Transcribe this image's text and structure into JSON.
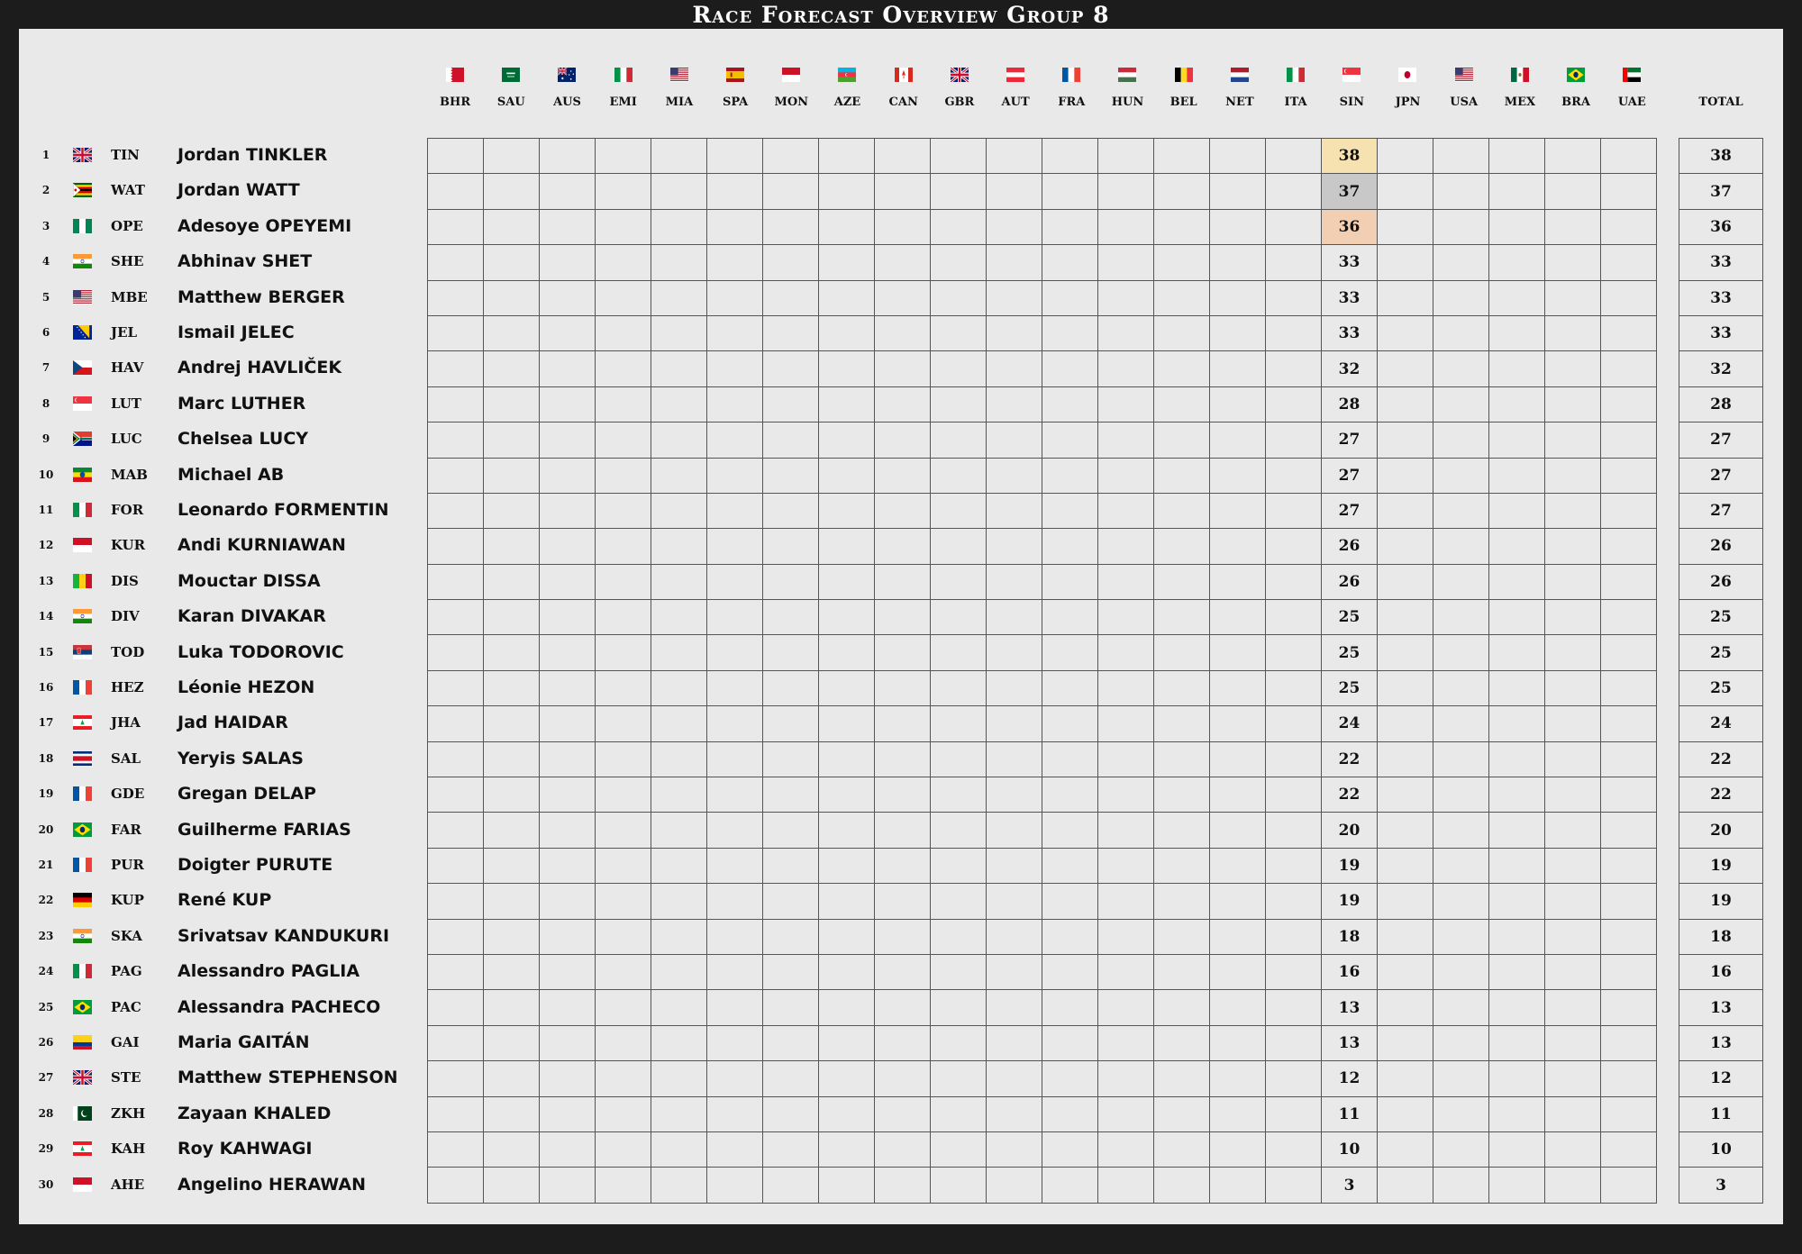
{
  "title": "Race Forecast Overview Group 8",
  "total_label": "TOTAL",
  "highlight_colors": {
    "first": "#f6e2b0",
    "second": "#c8c8c8",
    "third": "#f2cfb2"
  },
  "races": [
    {
      "code": "BHR",
      "flag": "bahrain-flag"
    },
    {
      "code": "SAU",
      "flag": "saudi-arabia-flag"
    },
    {
      "code": "AUS",
      "flag": "australia-flag"
    },
    {
      "code": "EMI",
      "flag": "italy-flag"
    },
    {
      "code": "MIA",
      "flag": "usa-flag"
    },
    {
      "code": "SPA",
      "flag": "spain-flag"
    },
    {
      "code": "MON",
      "flag": "monaco-flag"
    },
    {
      "code": "AZE",
      "flag": "azerbaijan-flag"
    },
    {
      "code": "CAN",
      "flag": "canada-flag"
    },
    {
      "code": "GBR",
      "flag": "uk-flag"
    },
    {
      "code": "AUT",
      "flag": "austria-flag"
    },
    {
      "code": "FRA",
      "flag": "france-flag"
    },
    {
      "code": "HUN",
      "flag": "hungary-flag"
    },
    {
      "code": "BEL",
      "flag": "belgium-flag"
    },
    {
      "code": "NET",
      "flag": "netherlands-flag"
    },
    {
      "code": "ITA",
      "flag": "italy-flag"
    },
    {
      "code": "SIN",
      "flag": "singapore-flag"
    },
    {
      "code": "JPN",
      "flag": "japan-flag"
    },
    {
      "code": "USA",
      "flag": "usa-flag"
    },
    {
      "code": "MEX",
      "flag": "mexico-flag"
    },
    {
      "code": "BRA",
      "flag": "brazil-flag"
    },
    {
      "code": "UAE",
      "flag": "uae-flag"
    }
  ],
  "score_column": "SIN",
  "players": [
    {
      "rank": "1",
      "flag": "uk-flag",
      "abbr": "TIN",
      "name": "Jordan TINKLER",
      "score": "38",
      "total": "38"
    },
    {
      "rank": "2",
      "flag": "zimbabwe-flag",
      "abbr": "WAT",
      "name": "Jordan WATT",
      "score": "37",
      "total": "37"
    },
    {
      "rank": "3",
      "flag": "nigeria-flag",
      "abbr": "OPE",
      "name": "Adesoye OPEYEMI",
      "score": "36",
      "total": "36"
    },
    {
      "rank": "4",
      "flag": "india-flag",
      "abbr": "SHE",
      "name": "Abhinav SHET",
      "score": "33",
      "total": "33"
    },
    {
      "rank": "5",
      "flag": "usa-flag",
      "abbr": "MBE",
      "name": "Matthew BERGER",
      "score": "33",
      "total": "33"
    },
    {
      "rank": "6",
      "flag": "bosnia-flag",
      "abbr": "JEL",
      "name": "Ismail JELEC",
      "score": "33",
      "total": "33"
    },
    {
      "rank": "7",
      "flag": "czech-flag",
      "abbr": "HAV",
      "name": "Andrej HAVLIČEK",
      "score": "32",
      "total": "32"
    },
    {
      "rank": "8",
      "flag": "singapore-flag",
      "abbr": "LUT",
      "name": "Marc LUTHER",
      "score": "28",
      "total": "28"
    },
    {
      "rank": "9",
      "flag": "south-africa-flag",
      "abbr": "LUC",
      "name": "Chelsea LUCY",
      "score": "27",
      "total": "27"
    },
    {
      "rank": "10",
      "flag": "ethiopia-flag",
      "abbr": "MAB",
      "name": "Michael AB",
      "score": "27",
      "total": "27"
    },
    {
      "rank": "11",
      "flag": "italy-flag",
      "abbr": "FOR",
      "name": "Leonardo FORMENTIN",
      "score": "27",
      "total": "27"
    },
    {
      "rank": "12",
      "flag": "indonesia-flag",
      "abbr": "KUR",
      "name": "Andi KURNIAWAN",
      "score": "26",
      "total": "26"
    },
    {
      "rank": "13",
      "flag": "mali-flag",
      "abbr": "DIS",
      "name": "Mouctar DISSA",
      "score": "26",
      "total": "26"
    },
    {
      "rank": "14",
      "flag": "india-flag",
      "abbr": "DIV",
      "name": "Karan DIVAKAR",
      "score": "25",
      "total": "25"
    },
    {
      "rank": "15",
      "flag": "serbia-flag",
      "abbr": "TOD",
      "name": "Luka TODOROVIC",
      "score": "25",
      "total": "25"
    },
    {
      "rank": "16",
      "flag": "france-flag",
      "abbr": "HEZ",
      "name": "Léonie HEZON",
      "score": "25",
      "total": "25"
    },
    {
      "rank": "17",
      "flag": "lebanon-flag",
      "abbr": "JHA",
      "name": "Jad HAIDAR",
      "score": "24",
      "total": "24"
    },
    {
      "rank": "18",
      "flag": "costa-rica-flag",
      "abbr": "SAL",
      "name": "Yeryis SALAS",
      "score": "22",
      "total": "22"
    },
    {
      "rank": "19",
      "flag": "france-flag",
      "abbr": "GDE",
      "name": "Gregan DELAP",
      "score": "22",
      "total": "22"
    },
    {
      "rank": "20",
      "flag": "brazil-flag",
      "abbr": "FAR",
      "name": "Guilherme FARIAS",
      "score": "20",
      "total": "20"
    },
    {
      "rank": "21",
      "flag": "france-flag",
      "abbr": "PUR",
      "name": "Doigter PURUTE",
      "score": "19",
      "total": "19"
    },
    {
      "rank": "22",
      "flag": "germany-flag",
      "abbr": "KUP",
      "name": "René KUP",
      "score": "19",
      "total": "19"
    },
    {
      "rank": "23",
      "flag": "india-flag",
      "abbr": "SKA",
      "name": "Srivatsav KANDUKURI",
      "score": "18",
      "total": "18"
    },
    {
      "rank": "24",
      "flag": "italy-flag",
      "abbr": "PAG",
      "name": "Alessandro PAGLIA",
      "score": "16",
      "total": "16"
    },
    {
      "rank": "25",
      "flag": "brazil-flag",
      "abbr": "PAC",
      "name": "Alessandra PACHECO",
      "score": "13",
      "total": "13"
    },
    {
      "rank": "26",
      "flag": "colombia-flag",
      "abbr": "GAI",
      "name": "Maria GAITÁN",
      "score": "13",
      "total": "13"
    },
    {
      "rank": "27",
      "flag": "uk-flag",
      "abbr": "STE",
      "name": "Matthew STEPHENSON",
      "score": "12",
      "total": "12"
    },
    {
      "rank": "28",
      "flag": "pakistan-flag",
      "abbr": "ZKH",
      "name": "Zayaan KHALED",
      "score": "11",
      "total": "11"
    },
    {
      "rank": "29",
      "flag": "lebanon-flag",
      "abbr": "KAH",
      "name": "Roy KAHWAGI",
      "score": "10",
      "total": "10"
    },
    {
      "rank": "30",
      "flag": "indonesia-flag",
      "abbr": "AHE",
      "name": "Angelino HERAWAN",
      "score": "3",
      "total": "3"
    }
  ]
}
